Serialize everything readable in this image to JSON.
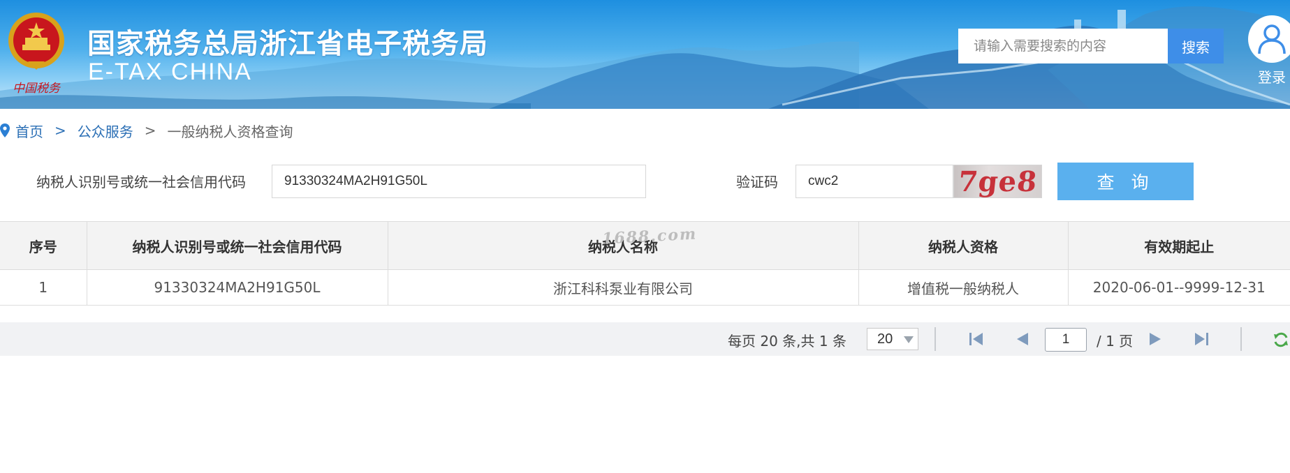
{
  "header": {
    "site_title": "国家税务总局浙江省电子税务局",
    "site_subtitle": "E-TAX CHINA",
    "emblem_caption": "中国税务",
    "search_placeholder": "请输入需要搜索的内容",
    "search_button": "搜索",
    "login_label": "登录"
  },
  "breadcrumb": {
    "home": "首页",
    "section": "公众服务",
    "current": "一般纳税人资格查询",
    "separator": ">"
  },
  "query_form": {
    "tax_id_label": "纳税人识别号或统一社会信用代码",
    "tax_id_value": "91330324MA2H91G50L",
    "captcha_label": "验证码",
    "captcha_value": "cwc2",
    "captcha_image_text": "7ge8",
    "query_button": "查 询"
  },
  "results_table": {
    "columns": [
      "序号",
      "纳税人识别号或统一社会信用代码",
      "纳税人名称",
      "纳税人资格",
      "有效期起止"
    ],
    "rows": [
      [
        "1",
        "91330324MA2H91G50L",
        "浙江科科泵业有限公司",
        "增值税一般纳税人",
        "2020-06-01--9999-12-31"
      ]
    ],
    "watermark": "1688.com"
  },
  "pager": {
    "info": "每页 20 条,共 1 条",
    "page_size": "20",
    "current_page": "1",
    "total_pages": "/ 1 页"
  },
  "colors": {
    "banner_blue": "#1e8fe0",
    "search_button": "#3e8ee8",
    "query_button": "#5ab0ee",
    "link": "#2b6fb5",
    "captcha_text": "#c7313a"
  },
  "icons": [
    "emblem-icon",
    "user-icon",
    "location-pin-icon",
    "first-page-icon",
    "prev-page-icon",
    "next-page-icon",
    "last-page-icon",
    "refresh-icon"
  ]
}
